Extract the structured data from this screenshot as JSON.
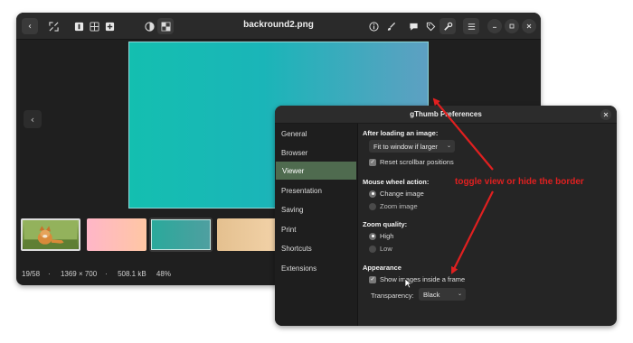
{
  "window": {
    "title": "backround2.png",
    "toolbar_left": [
      "back-icon",
      "fullscreen-icon",
      "single-view-icon",
      "grid-view-icon",
      "add-icon",
      "color-icon",
      "checker-icon"
    ],
    "toolbar_right": [
      "info-icon",
      "brush-icon",
      "comment-icon",
      "tag-icon",
      "wrench-icon",
      "menu-icon",
      "minimize-icon",
      "maximize-icon",
      "close-icon"
    ],
    "prev_arrow": "‹",
    "back_arrow": "‹"
  },
  "thumbnails": [
    {
      "name": "fox photo",
      "selected": false
    },
    {
      "name": "pink gradient",
      "selected": false
    },
    {
      "name": "teal gradient",
      "selected": true
    },
    {
      "name": "beige gradient",
      "selected": false
    }
  ],
  "status": {
    "position": "19/58",
    "dimensions": "1369 × 700",
    "size": "508.1 kB",
    "zoom": "48%"
  },
  "preferences": {
    "title": "gThumb Preferences",
    "nav": [
      "General",
      "Browser",
      "Viewer",
      "Presentation",
      "Saving",
      "Print",
      "Shortcuts",
      "Extensions"
    ],
    "active_nav": "Viewer",
    "after_loading": {
      "title": "After loading an image:",
      "fit_value": "Fit to window if larger",
      "reset_scrollbar": "Reset scrollbar positions"
    },
    "mouse_wheel": {
      "title": "Mouse wheel action:",
      "change_image": "Change image",
      "zoom_image": "Zoom image"
    },
    "zoom_quality": {
      "title": "Zoom quality:",
      "high": "High",
      "low": "Low"
    },
    "appearance": {
      "title": "Appearance",
      "show_frame": "Show images inside a frame",
      "transparency_label": "Transparency:",
      "transparency_value": "Black"
    }
  },
  "annotation": {
    "text": "toggle view or hide the border",
    "color": "#e02020"
  },
  "colors": {
    "accent_nav": "#4f6b4f",
    "window_bg": "#1f1f1f",
    "annotation": "#e02020"
  }
}
